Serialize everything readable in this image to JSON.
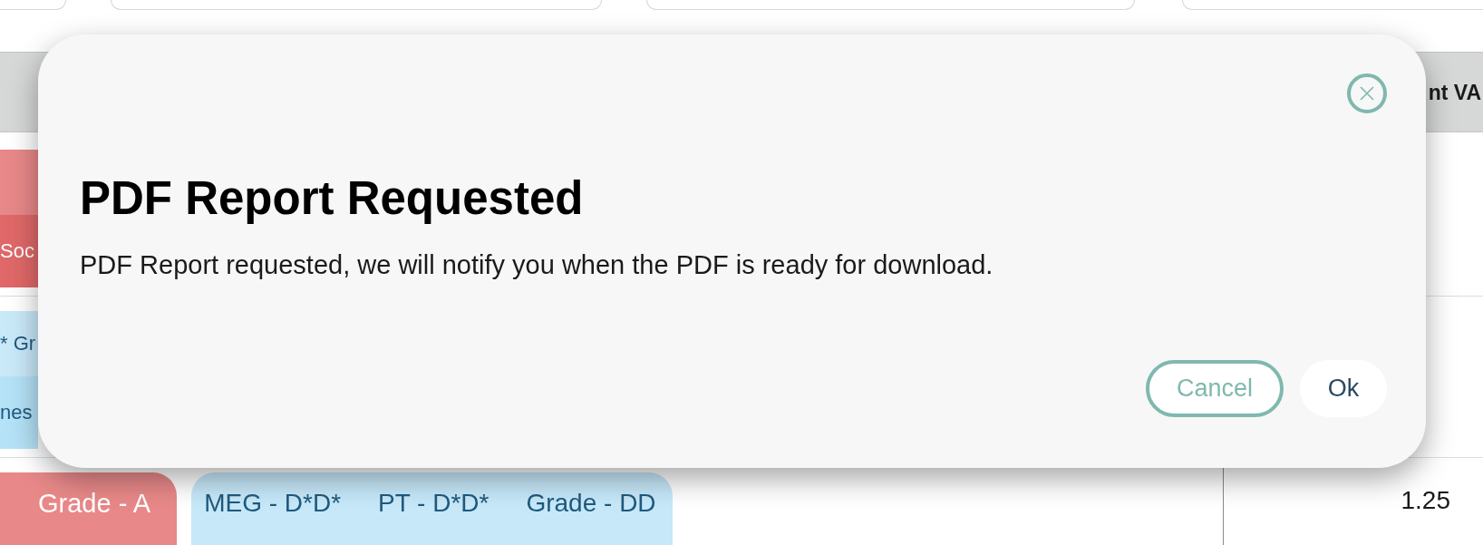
{
  "table": {
    "columns": [
      "nt VA"
    ],
    "rows": [
      {
        "kind": "stacked",
        "tags": [
          {
            "color": "#e88888"
          },
          {
            "text": "Soc",
            "color": "#e06868"
          }
        ]
      },
      {
        "kind": "stacked",
        "tags": [
          {
            "text": "* Gr",
            "color": "#c9e9f9"
          },
          {
            "text": "nes",
            "color": "#b5e2f7"
          }
        ]
      },
      {
        "kind": "inline",
        "tags": [
          {
            "text": "Grade - A",
            "color": "#e88888"
          },
          {
            "texts": [
              "MEG - D*D*",
              "PT - D*D*",
              "Grade - DD"
            ],
            "color": "#c6e8f9"
          }
        ],
        "value": "1.25"
      }
    ]
  },
  "dialog": {
    "title": "PDF Report Requested",
    "message": "PDF Report requested, we will notify you when the PDF is ready for download.",
    "buttons": [
      {
        "label": "Cancel",
        "kind": "secondary"
      },
      {
        "label": "Ok",
        "kind": "primary"
      }
    ]
  }
}
